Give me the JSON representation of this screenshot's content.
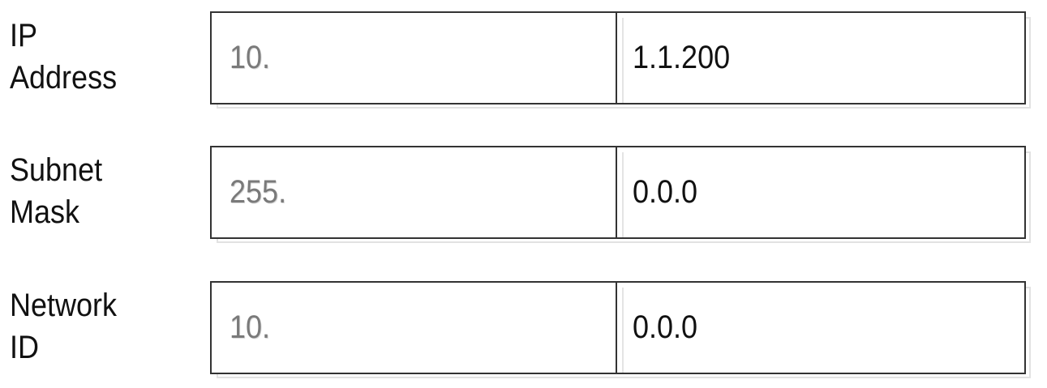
{
  "rows": [
    {
      "label_line1": "IP",
      "label_line2": "Address",
      "prefix": "10.",
      "suffix": "1.1.200"
    },
    {
      "label_line1": "Subnet",
      "label_line2": "Mask",
      "prefix": "255.",
      "suffix": "0.0.0"
    },
    {
      "label_line1": "Network",
      "label_line2": "ID",
      "prefix": "10.",
      "suffix": "0.0.0"
    }
  ],
  "colors": {
    "border": "#333333",
    "prefix_text": "#7a7a7a",
    "value_text": "#111111",
    "shadow": "#e2e2e2"
  }
}
